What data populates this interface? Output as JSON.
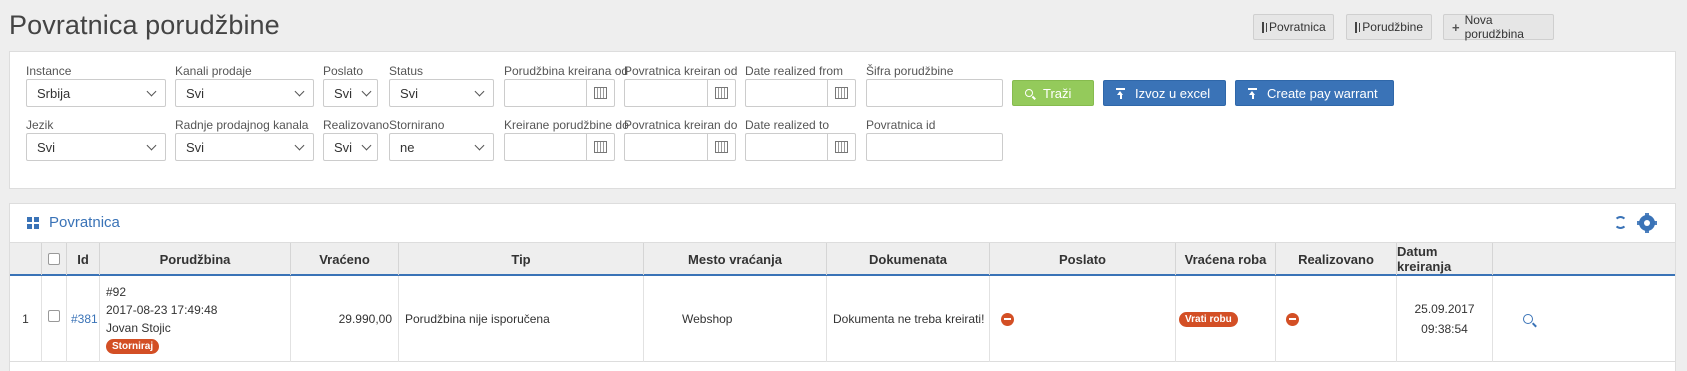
{
  "page": {
    "title": "Povratnica porudžbine"
  },
  "top_buttons": {
    "povratnica": "Povratnica",
    "porudzbine": "Porudžbine",
    "nova": "Nova porudžbina"
  },
  "filters": {
    "instance": {
      "label": "Instance",
      "value": "Srbija"
    },
    "kanali": {
      "label": "Kanali prodaje",
      "value": "Svi"
    },
    "poslato": {
      "label": "Poslato",
      "value": "Svi"
    },
    "status": {
      "label": "Status",
      "value": "Svi"
    },
    "porudzbina_kreirana_od": {
      "label": "Porudžbina kreirana od"
    },
    "povratnica_kreiran_od": {
      "label": "Povratnica kreiran od"
    },
    "date_realized_from": {
      "label": "Date realized from"
    },
    "sifra": {
      "label": "Šifra porudžbine"
    },
    "jezik": {
      "label": "Jezik",
      "value": "Svi"
    },
    "radnje": {
      "label": "Radnje prodajnog kanala",
      "value": "Svi"
    },
    "realizovano": {
      "label": "Realizovano",
      "value": "Svi"
    },
    "stornirano": {
      "label": "Stornirano",
      "value": "ne"
    },
    "kreirane_do": {
      "label": "Kreirane porudžbine do"
    },
    "povratnica_kreiran_do": {
      "label": "Povratnica kreiran do"
    },
    "date_realized_to": {
      "label": "Date realized to"
    },
    "povratnica_id": {
      "label": "Povratnica id"
    }
  },
  "actions": {
    "trazi": "Traži",
    "excel": "Izvoz u excel",
    "warrant": "Create pay warrant"
  },
  "grid": {
    "title": "Povratnica",
    "columns": [
      "Id",
      "Porudžbina",
      "Vraćeno",
      "Tip",
      "Mesto vraćanja",
      "Dokumenata",
      "Poslato",
      "Vraćena roba",
      "Realizovano",
      "Datum kreiranja"
    ],
    "rows": [
      {
        "num": "1",
        "id": "#381",
        "order_no": "#92",
        "order_date": "2017-08-23 17:49:48",
        "customer": "Jovan Stojic",
        "storno_badge": "Storniraj",
        "vraceno": "29.990,00",
        "tip": "Porudžbina nije isporučena",
        "mesto": "Webshop",
        "dokumenata": "Dokumenta ne treba kreirati!",
        "vracena_roba_badge": "Vrati robu",
        "datum": "25.09.2017",
        "vreme": "09:38:54"
      }
    ]
  },
  "colors": {
    "accent": "#3a73b7",
    "green": "#94ca5b",
    "danger": "#d34f25"
  }
}
